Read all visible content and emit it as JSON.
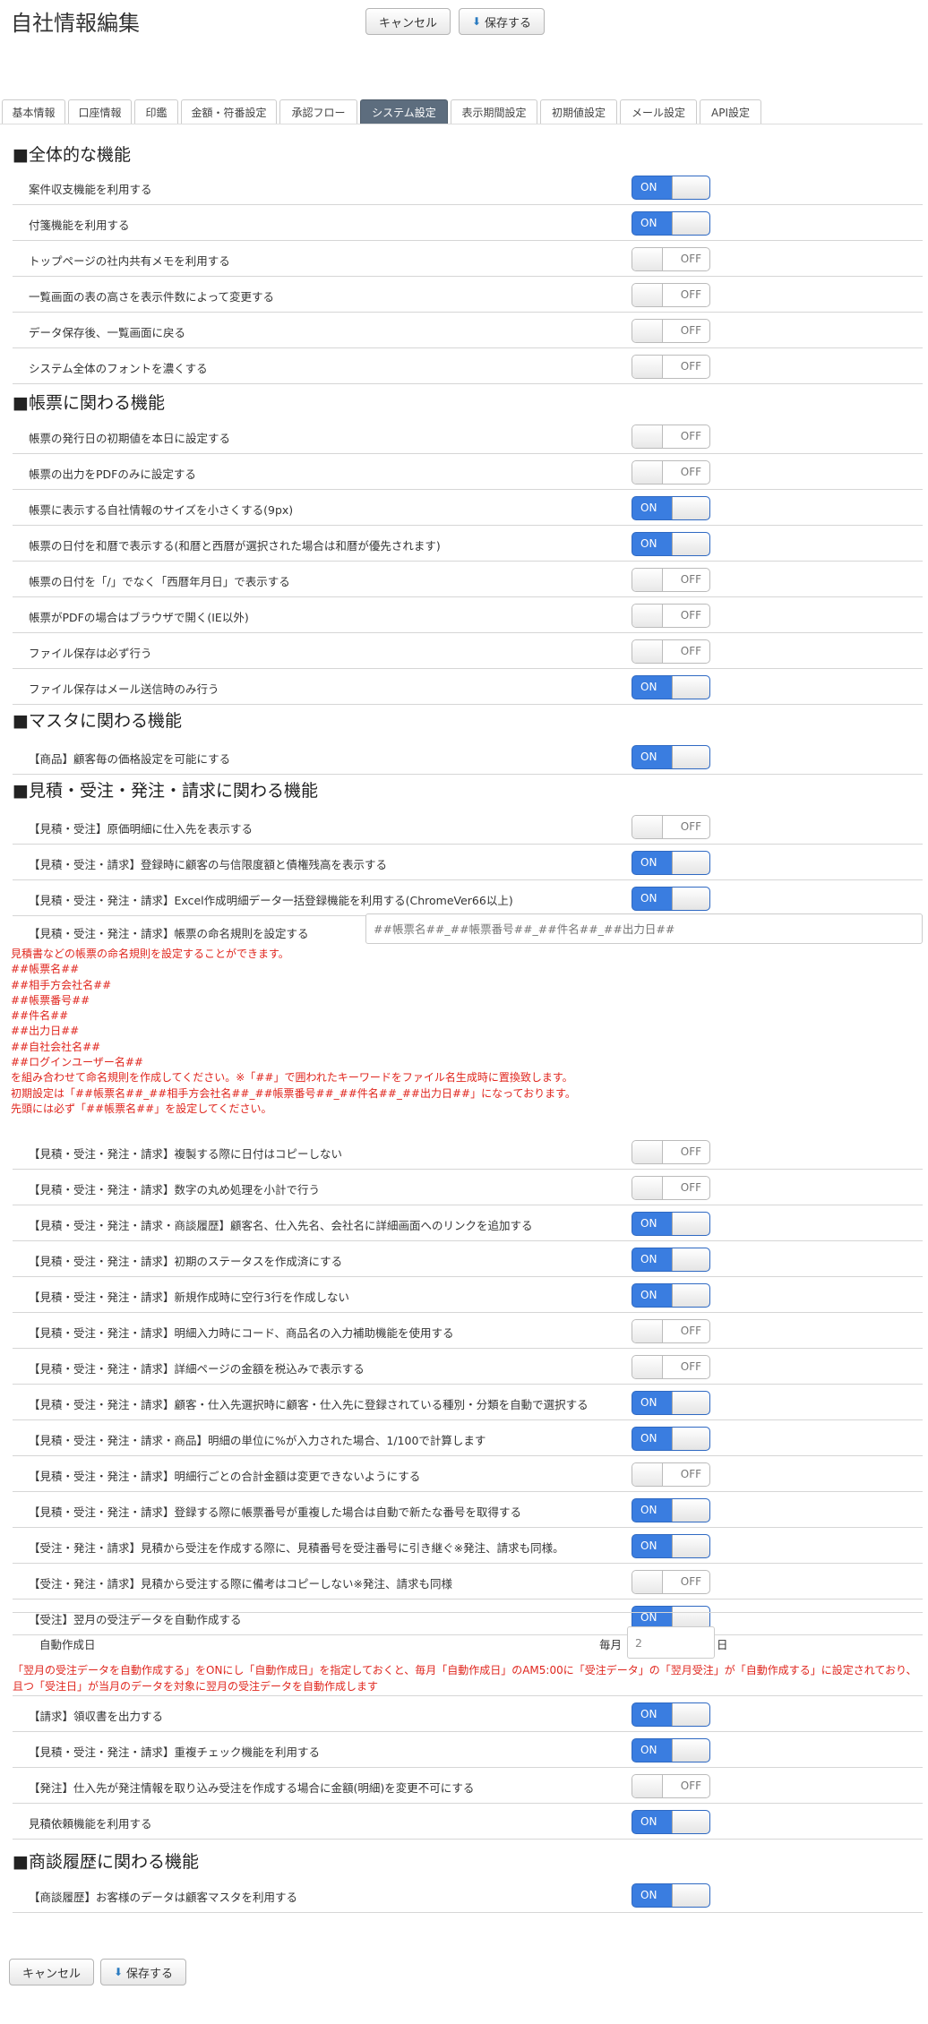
{
  "page": {
    "title": "自社情報編集"
  },
  "actions": {
    "cancel": "キャンセル",
    "save": "保存する"
  },
  "tabs": [
    "基本情報",
    "口座情報",
    "印鑑",
    "金額・符番設定",
    "承認フロー",
    "システム設定",
    "表示期間設定",
    "初期値設定",
    "メール設定",
    "API設定"
  ],
  "active_tab": "システム設定",
  "sections": [
    "全体的な機能",
    "帳票に関わる機能",
    "マスタに関わる機能",
    "見積・受注・発注・請求に関わる機能",
    "商談履歴に関わる機能"
  ],
  "toggle_text": {
    "on": "ON",
    "off": "OFF"
  },
  "settings": [
    {
      "label": "案件収支機能を利用する",
      "on": true
    },
    {
      "label": "付箋機能を利用する",
      "on": true
    },
    {
      "label": "トップページの社内共有メモを利用する",
      "on": false
    },
    {
      "label": "一覧画面の表の高さを表示件数によって変更する",
      "on": false
    },
    {
      "label": "データ保存後、一覧画面に戻る",
      "on": false
    },
    {
      "label": "システム全体のフォントを濃くする",
      "on": false
    },
    {
      "label": "帳票の発行日の初期値を本日に設定する",
      "on": false
    },
    {
      "label": "帳票の出力をPDFのみに設定する",
      "on": false
    },
    {
      "label": "帳票に表示する自社情報のサイズを小さくする(9px)",
      "on": true
    },
    {
      "label": "帳票の日付を和暦で表示する(和暦と西暦が選択された場合は和暦が優先されます)",
      "on": true
    },
    {
      "label": "帳票の日付を「/」でなく「西暦年月日」で表示する",
      "on": false
    },
    {
      "label": "帳票がPDFの場合はブラウザで開く(IE以外)",
      "on": false
    },
    {
      "label": "ファイル保存は必ず行う",
      "on": false
    },
    {
      "label": "ファイル保存はメール送信時のみ行う",
      "on": true
    },
    {
      "label": "【商品】顧客毎の価格設定を可能にする",
      "on": true
    },
    {
      "label": "【見積・受注】原価明細に仕入先を表示する",
      "on": false
    },
    {
      "label": "【見積・受注・請求】登録時に顧客の与信限度額と債権残高を表示する",
      "on": true
    },
    {
      "label": "【見積・受注・発注・請求】Excel作成明細データ一括登録機能を利用する(ChromeVer66以上)",
      "on": true
    },
    {
      "label": "【見積・受注・発注・請求】帳票の命名規則を設定する"
    },
    {
      "label": "【見積・受注・発注・請求】複製する際に日付はコピーしない",
      "on": false
    },
    {
      "label": "【見積・受注・発注・請求】数字の丸め処理を小計で行う",
      "on": false
    },
    {
      "label": "【見積・受注・発注・請求・商談履歴】顧客名、仕入先名、会社名に詳細画面へのリンクを追加する",
      "on": true
    },
    {
      "label": "【見積・受注・発注・請求】初期のステータスを作成済にする",
      "on": true
    },
    {
      "label": "【見積・受注・発注・請求】新規作成時に空行3行を作成しない",
      "on": true
    },
    {
      "label": "【見積・受注・発注・請求】明細入力時にコード、商品名の入力補助機能を使用する",
      "on": false
    },
    {
      "label": "【見積・受注・発注・請求】詳細ページの金額を税込みで表示する",
      "on": false
    },
    {
      "label": "【見積・受注・発注・請求】顧客・仕入先選択時に顧客・仕入先に登録されている種別・分類を自動で選択する",
      "on": true
    },
    {
      "label": "【見積・受注・発注・請求・商品】明細の単位に%が入力された場合、1/100で計算します",
      "on": true
    },
    {
      "label": "【見積・受注・発注・請求】明細行ごとの合計金額は変更できないようにする",
      "on": false
    },
    {
      "label": "【見積・受注・発注・請求】登録する際に帳票番号が重複した場合は自動で新たな番号を取得する",
      "on": true
    },
    {
      "label": "【受注・発注・請求】見積から受注を作成する際に、見積番号を受注番号に引き継ぐ※発注、請求も同様。",
      "on": true
    },
    {
      "label": "【受注・発注・請求】見積から受注する際に備考はコピーしない※発注、請求も同様",
      "on": false
    },
    {
      "label": "【受注】翌月の受注データを自動作成する",
      "on": true
    },
    {
      "label": "【請求】領収書を出力する",
      "on": true
    },
    {
      "label": "【見積・受注・発注・請求】重複チェック機能を利用する",
      "on": true
    },
    {
      "label": "【発注】仕入先が発注情報を取り込み受注を作成する場合に金額(明細)を変更不可にする",
      "on": false
    },
    {
      "label": "見積依頼機能を利用する",
      "on": true
    },
    {
      "label": "【商談履歴】お客様のデータは顧客マスタを利用する",
      "on": true
    }
  ],
  "naming": {
    "placeholder": "##帳票名##_##帳票番号##_##件名##_##出力日##",
    "note": "見積書などの帳票の命名規則を設定することができます。\n##帳票名##\n##相手方会社名##\n##帳票番号##\n##件名##\n##出力日##\n##自社会社名##\n##ログインユーザー名##\nを組み合わせて命名規則を作成してください。※「##」で囲われたキーワードをファイル名生成時に置換致します。\n初期設定は「##帳票名##_##相手方会社名##_##帳票番号##_##件名##_##出力日##」になっております。\n先頭には必ず「##帳票名##」を設定してください。"
  },
  "auto_create": {
    "label": "自動作成日",
    "prefix": "毎月",
    "value": "2",
    "suffix": "日",
    "note": "「翌月の受注データを自動作成する」をONにし「自動作成日」を指定しておくと、毎月「自動作成日」のAM5:00に「受注データ」の「翌月受注」が「自動作成する」に設定されており、且つ「受注日」が当月のデータを対象に翌月の受注データを自動作成します"
  }
}
